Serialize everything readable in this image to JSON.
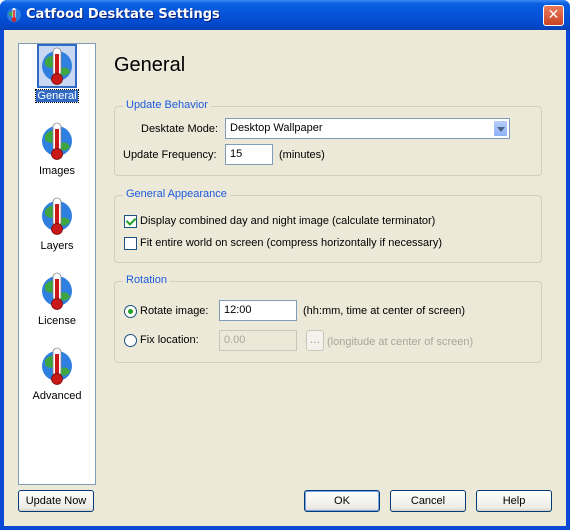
{
  "window": {
    "title": "Catfood Desktate Settings",
    "close_glyph": "✕"
  },
  "nav": {
    "items": [
      {
        "label": "General",
        "selected": true,
        "icon": "globe-thermometer-icon"
      },
      {
        "label": "Images",
        "selected": false,
        "icon": "globe-thermometer-icon"
      },
      {
        "label": "Layers",
        "selected": false,
        "icon": "globe-thermometer-icon"
      },
      {
        "label": "License",
        "selected": false,
        "icon": "globe-thermometer-icon"
      },
      {
        "label": "Advanced",
        "selected": false,
        "icon": "globe-thermometer-icon"
      }
    ]
  },
  "page": {
    "heading": "General"
  },
  "update_behavior": {
    "title": "Update Behavior",
    "mode_label": "Desktate Mode:",
    "mode_value": "Desktop Wallpaper",
    "freq_label": "Update Frequency:",
    "freq_value": "15",
    "freq_unit": "(minutes)"
  },
  "appearance": {
    "title": "General Appearance",
    "combined_label": "Display combined day and night image (calculate terminator)",
    "combined_checked": true,
    "fit_label": "Fit entire world on screen (compress horizontally if necessary)",
    "fit_checked": false
  },
  "rotation": {
    "title": "Rotation",
    "rotate_label": "Rotate image:",
    "rotate_value": "12:00",
    "rotate_hint": "(hh:mm, time at center of screen)",
    "fix_label": "Fix location:",
    "fix_value": "0.00",
    "fix_button": "...",
    "fix_hint": "(longitude at center of screen)"
  },
  "buttons": {
    "update_now": "Update Now",
    "ok": "OK",
    "cancel": "Cancel",
    "help": "Help"
  },
  "colors": {
    "accent": "#1d5adf",
    "title_bar": "#0553d9",
    "face": "#ece9d8"
  }
}
